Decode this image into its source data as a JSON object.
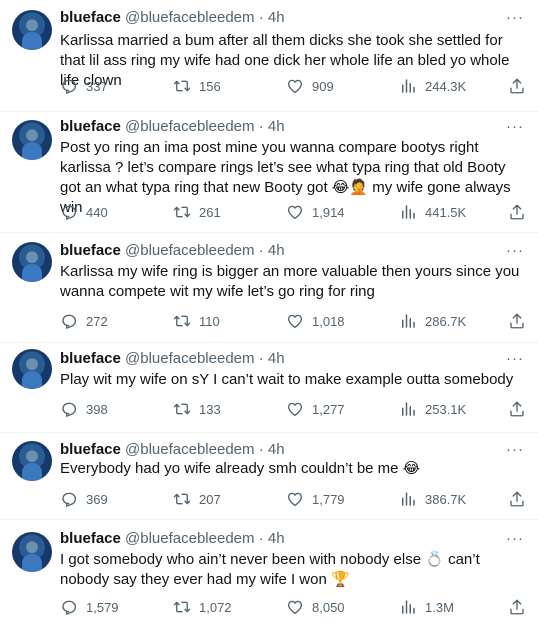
{
  "tweets": [
    {
      "name": "blueface",
      "handle": "@bluefacebleedem",
      "time": "4h",
      "text": "Karlissa married a bum after all them dicks she took she settled for that lil ass ring my wife had one dick her whole life an bled yo whole life clown",
      "replies": "337",
      "retweets": "156",
      "likes": "909",
      "views": "244.3K"
    },
    {
      "name": "blueface",
      "handle": "@bluefacebleedem",
      "time": "4h",
      "text": "Post yo ring an ima post mine you wanna compare bootys right karlissa ? let’s compare rings let’s see what typa ring that old Booty got an what typa ring that new Booty got 😂🤦 my wife gone always win",
      "replies": "440",
      "retweets": "261",
      "likes": "1,914",
      "views": "441.5K"
    },
    {
      "name": "blueface",
      "handle": "@bluefacebleedem",
      "time": "4h",
      "text": "Karlissa my wife ring is bigger an more valuable then yours since you wanna compete wit my wife let’s go ring for ring",
      "replies": "272",
      "retweets": "110",
      "likes": "1,018",
      "views": "286.7K"
    },
    {
      "name": "blueface",
      "handle": "@bluefacebleedem",
      "time": "4h",
      "text": "Play wit my wife on sY I can’t wait to make example outta somebody",
      "replies": "398",
      "retweets": "133",
      "likes": "1,277",
      "views": "253.1K"
    },
    {
      "name": "blueface",
      "handle": "@bluefacebleedem",
      "time": "4h",
      "text": "Everybody had yo wife already smh couldn’t be me 😂",
      "replies": "369",
      "retweets": "207",
      "likes": "1,779",
      "views": "386.7K"
    },
    {
      "name": "blueface",
      "handle": "@bluefacebleedem",
      "time": "4h",
      "text": "I got somebody who ain’t never been with nobody else 💍 can’t nobody say they ever had my wife I won 🏆",
      "replies": "1,579",
      "retweets": "1,072",
      "likes": "8,050",
      "views": "1.3M"
    }
  ],
  "icons": {
    "more": "more-icon",
    "reply": "reply-icon",
    "retweet": "retweet-icon",
    "like": "heart-icon",
    "views": "views-icon",
    "share": "share-icon"
  },
  "colors": {
    "text": "#0f1419",
    "secondary": "#536471",
    "divider": "#eff3f4"
  }
}
